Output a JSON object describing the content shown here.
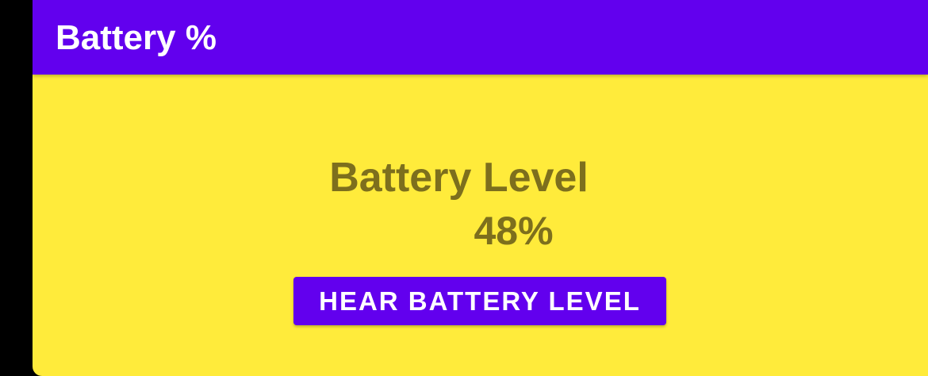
{
  "app_bar": {
    "title": "Battery %",
    "color": "#6200ee"
  },
  "main": {
    "background_color": "#ffeb3b",
    "text_color": "#7d6f1d",
    "battery_label": "Battery Level",
    "battery_value": "48%",
    "hear_button_label": "HEAR BATTERY LEVEL"
  }
}
